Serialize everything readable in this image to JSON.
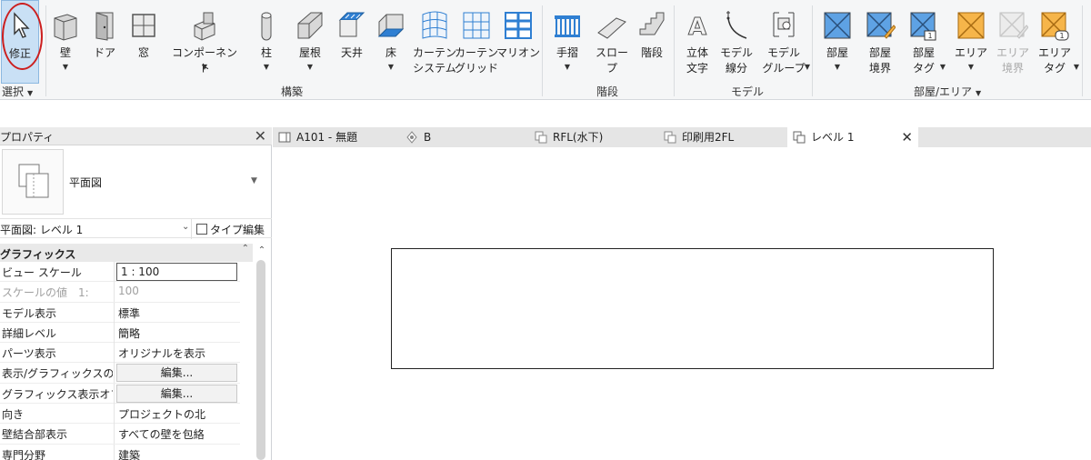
{
  "ribbon": {
    "buttons": [
      {
        "label": "修正",
        "icon": "cursor-arrow-icon"
      },
      {
        "label": "壁",
        "icon": "wall-icon"
      },
      {
        "label": "ドア",
        "icon": "door-icon"
      },
      {
        "label": "窓",
        "icon": "window-icon"
      },
      {
        "label": "コンポーネント",
        "icon": "component-icon"
      },
      {
        "label": "柱",
        "icon": "column-icon"
      },
      {
        "label": "屋根",
        "icon": "roof-icon"
      },
      {
        "label": "天井",
        "icon": "ceiling-icon"
      },
      {
        "label": "床",
        "icon": "floor-icon"
      },
      {
        "label": "カーテン\nシステム",
        "icon": "curtain-system-icon"
      },
      {
        "label": "カーテン\nグリッド",
        "icon": "curtain-grid-icon"
      },
      {
        "label": "マリオン",
        "icon": "mullion-icon"
      },
      {
        "label": "手摺",
        "icon": "railing-icon"
      },
      {
        "label": "スロープ",
        "icon": "ramp-icon"
      },
      {
        "label": "階段",
        "icon": "stair-icon"
      },
      {
        "label": "立体\n文字",
        "icon": "model-text-icon"
      },
      {
        "label": "モデル\n線分",
        "icon": "model-line-icon"
      },
      {
        "label": "モデル\nグループ",
        "icon": "model-group-icon"
      },
      {
        "label": "部屋",
        "icon": "room-icon"
      },
      {
        "label": "部屋\n境界",
        "icon": "room-separator-icon"
      },
      {
        "label": "部屋\nタグ",
        "icon": "room-tag-icon"
      },
      {
        "label": "エリア",
        "icon": "area-icon"
      },
      {
        "label": "エリア\n境界",
        "icon": "area-boundary-icon"
      },
      {
        "label": "エリア\nタグ",
        "icon": "area-tag-icon"
      }
    ],
    "panels": {
      "select": "選択",
      "build": "構築",
      "circulation": "階段",
      "model": "モデル",
      "room_area": "部屋/エリア"
    }
  },
  "properties": {
    "title": "プロパティ",
    "type_name": "平面図",
    "filter_label": "平面図: レベル 1",
    "edit_type": "タイプ編集",
    "group": "グラフィックス",
    "rows": [
      {
        "key": "ビュー スケール",
        "value": "1 : 100"
      },
      {
        "key": "スケールの値　1:",
        "value": "100"
      },
      {
        "key": "モデル表示",
        "value": "標準"
      },
      {
        "key": "詳細レベル",
        "value": "簡略"
      },
      {
        "key": "パーツ表示",
        "value": "オリジナルを表示"
      },
      {
        "key": "表示/グラフィックスの...",
        "value": "編集..."
      },
      {
        "key": "グラフィックス表示オプ...",
        "value": "編集..."
      },
      {
        "key": "向き",
        "value": "プロジェクトの北"
      },
      {
        "key": "壁結合部表示",
        "value": "すべての壁を包絡"
      },
      {
        "key": "専門分野",
        "value": "建築"
      }
    ]
  },
  "tabs": [
    {
      "label": "A101 - 無題"
    },
    {
      "label": "B"
    },
    {
      "label": "RFL(水下)"
    },
    {
      "label": "印刷用2FL"
    },
    {
      "label": "レベル 1"
    }
  ],
  "colors": {
    "selected_button": "#c9e0f5",
    "annotation_circle": "#cc1f1f",
    "icon_blue": "#2f7fd2",
    "area_orange": "#f6b54a"
  }
}
